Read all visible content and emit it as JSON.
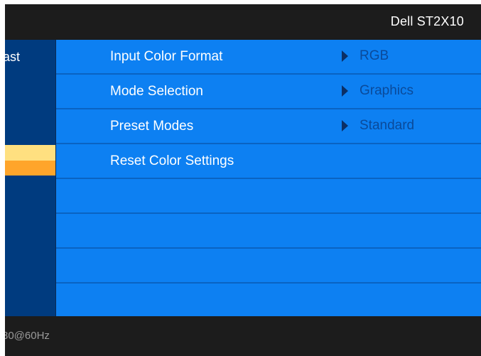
{
  "header": {
    "brand": "Dell ST2X10"
  },
  "sidebar": {
    "visible_label": "ast",
    "selected_item": {
      "highlight_colors": [
        "#ffe080",
        "#ffa52b"
      ]
    }
  },
  "menu": {
    "rows": [
      {
        "label": "Input Color Format",
        "value": "RGB"
      },
      {
        "label": "Mode Selection",
        "value": "Graphics"
      },
      {
        "label": "Preset Modes",
        "value": "Standard"
      },
      {
        "label": "Reset Color Settings",
        "value": ""
      },
      {
        "label": "",
        "value": ""
      },
      {
        "label": "",
        "value": ""
      },
      {
        "label": "",
        "value": ""
      },
      {
        "label": "",
        "value": ""
      }
    ]
  },
  "footer": {
    "resolution_text": "80@60Hz"
  },
  "colors": {
    "panel_bg": "#0d80f2",
    "sidebar_bg": "#003b7f",
    "header_bg": "#1c1c1c",
    "value_text": "#0a4a9a"
  }
}
